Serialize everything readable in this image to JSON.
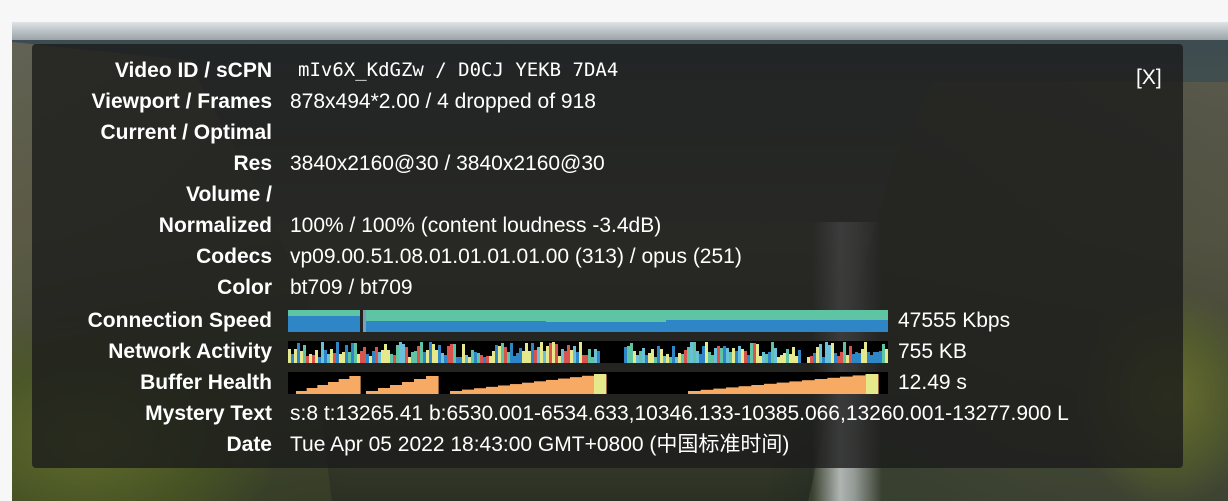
{
  "panel": {
    "close_label": "[X]",
    "video_id": {
      "label": "Video ID / sCPN",
      "value": "mIv6X_KdGZw / D0CJ YEKB 7DA4"
    },
    "viewport": {
      "label": "Viewport / Frames",
      "value": "878x494*2.00 / 4 dropped of 918"
    },
    "current_optimal": {
      "label": "Current / Optimal"
    },
    "res": {
      "label": "Res",
      "value": "3840x2160@30 / 3840x2160@30"
    },
    "volume": {
      "label": "Volume /"
    },
    "normalized": {
      "label": "Normalized",
      "value": "100% / 100% (content loudness -3.4dB)"
    },
    "codecs": {
      "label": "Codecs",
      "value": "vp09.00.51.08.01.01.01.01.00 (313) / opus (251)"
    },
    "color": {
      "label": "Color",
      "value": "bt709 / bt709"
    },
    "connection_speed": {
      "label": "Connection Speed",
      "value": "47555 Kbps"
    },
    "network_activity": {
      "label": "Network Activity",
      "value": "755 KB"
    },
    "buffer_health": {
      "label": "Buffer Health",
      "value": "12.49 s"
    },
    "mystery_text": {
      "label": "Mystery Text",
      "value": "s:8 t:13265.41 b:6530.001-6534.633,10346.133-10385.066,13260.001-13277.900 L"
    },
    "date": {
      "label": "Date",
      "value": "Tue Apr 05 2022 18:43:00 GMT+0800 (中国标准时间)"
    }
  },
  "colors": {
    "panel_bg": "#1c1c1c",
    "speed_teal": "#5fc4a4",
    "speed_blue": "#2f86c6",
    "buffer_orange": "#f6aa64",
    "buffer_yellow": "#e6e88c"
  }
}
